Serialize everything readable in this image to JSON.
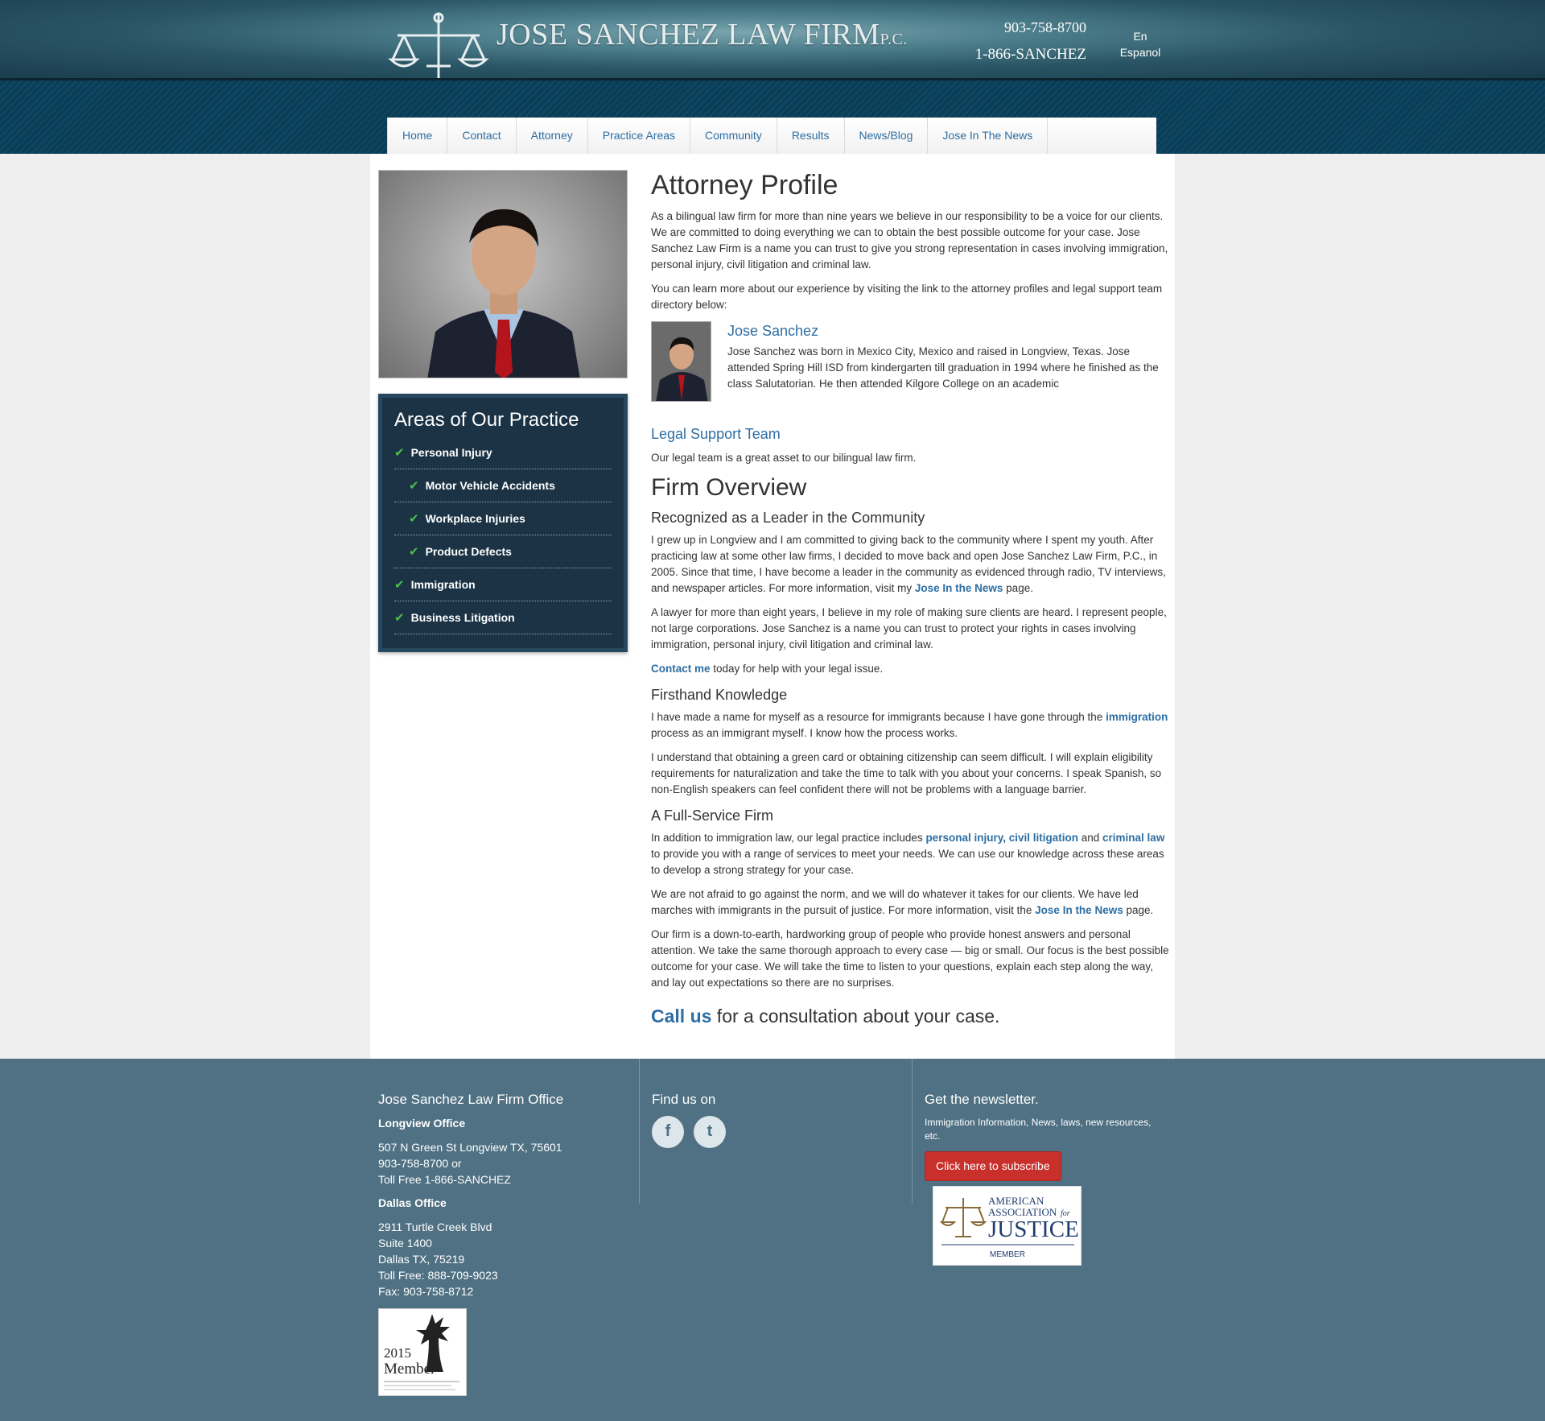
{
  "header": {
    "firm_name": "JOSE SANCHEZ LAW FIRM",
    "firm_suffix": "P.C.",
    "phone_local": "903-758-8700",
    "phone_toll": "1-866-SANCHEZ",
    "lang_line1": "En",
    "lang_line2": "Espanol"
  },
  "nav": {
    "items": [
      "Home",
      "Contact",
      "Attorney",
      "Practice Areas",
      "Community",
      "Results",
      "News/Blog",
      "Jose In The News"
    ]
  },
  "sidebar": {
    "areas_title": "Areas of Our Practice",
    "items": [
      "Personal Injury",
      "Motor Vehicle Accidents",
      "Workplace Injuries",
      "Product Defects",
      "Immigration",
      "Business Litigation"
    ]
  },
  "content": {
    "title": "Attorney Profile",
    "intro": "As a bilingual law firm for more than nine years we believe in our responsibility to be a voice for our clients. We are committed to doing everything we can to obtain the best possible outcome for your case. Jose Sanchez Law Firm is a name you can trust to give you strong representation in cases involving immigration, personal injury, civil litigation and criminal law.",
    "learn_more": "You can learn more about our experience by visiting the link to the attorney profiles and legal support team directory below:",
    "attorney_name": "Jose Sanchez",
    "attorney_bio": "Jose Sanchez was born in Mexico City, Mexico and raised in Longview, Texas. Jose attended Spring Hill ISD from kindergarten till graduation in 1994 where he finished as the class Salutatorian. He then attended Kilgore College on an academic",
    "team_title": "Legal Support Team",
    "team_text": "Our legal team is a great asset to our bilingual law firm.",
    "overview_title": "Firm Overview",
    "leader_title": "Recognized as a Leader in the Community",
    "leader_p1_a": "I grew up in Longview and I am committed to giving back to the community where I spent my youth. After practicing law at some other law firms, I decided to move back and open Jose Sanchez Law Firm, P.C., in 2005. Since that time, I have become a leader in the community as evidenced through radio, TV interviews, and newspaper articles. For more information, visit my ",
    "leader_p1_link": "Jose In the News",
    "leader_p1_b": " page.",
    "leader_p2": "A lawyer for more than eight years, I believe in my role of making sure clients are heard. I represent people, not large corporations. Jose Sanchez is a name you can trust to protect your rights in cases involving immigration, personal injury, civil litigation and criminal law.",
    "contact_link": "Contact me",
    "contact_rest": " today for help with your legal issue.",
    "firsthand_title": "Firsthand Knowledge",
    "firsthand_p1_a": "I have made a name for myself as a resource for immigrants because I have gone through the ",
    "firsthand_p1_link": "immigration",
    "firsthand_p1_b": " process as an immigrant myself. I know how the process works.",
    "firsthand_p2": "I understand that obtaining a green card or obtaining citizenship can seem difficult. I will explain eligibility requirements for naturalization and take the time to talk with you about your concerns. I speak Spanish, so non-English speakers can feel confident there will not be problems with a language barrier.",
    "fullservice_title": "A Full-Service Firm",
    "fs_p1_a": "In addition to immigration law, our legal practice includes ",
    "fs_link_pi": "personal injury",
    "fs_comma": ", ",
    "fs_link_cl": "civil litigation",
    "fs_and": " and ",
    "fs_link_crim": "criminal law",
    "fs_p1_b": " to provide you with a range of services to meet your needs. We can use our knowledge across these areas to develop a strong strategy for your case.",
    "fs_p2_a": "We are not afraid to go against the norm, and we will do whatever it takes for our clients. We have led marches with immigrants in the pursuit of justice. For more information, visit the ",
    "fs_p2_link": "Jose In the News",
    "fs_p2_b": " page.",
    "fs_p3": "Our firm is a down-to-earth, hardworking group of people who provide honest answers and personal attention. We take the same thorough approach to every case — big or small. Our focus is the best possible outcome for your case. We will take the time to listen to your questions, explain each step along the way, and lay out expectations so there are no surprises.",
    "callus_link": "Call us",
    "callus_rest": " for a consultation about your case."
  },
  "footer": {
    "office_title": "Jose Sanchez Law Firm Office",
    "longview_title": "Longview Office",
    "longview_addr": "507 N Green St Longview TX, 75601",
    "longview_phone": "903-758-8700 or",
    "longview_toll": "Toll Free 1-866-SANCHEZ",
    "dallas_title": "Dallas Office",
    "dallas_l1": "2911 Turtle Creek Blvd",
    "dallas_l2": "Suite 1400",
    "dallas_l3": "Dallas TX, 75219",
    "dallas_l4": "Toll Free: 888-709-9023",
    "dallas_l5": "Fax: 903-758-8712",
    "find_title": "Find us on",
    "facebook_glyph": "f",
    "twitter_glyph": "t",
    "news_title": "Get the newsletter.",
    "news_blurb": "Immigration Information, News, laws, new resources, etc.",
    "subscribe_label": "Click here to subscribe",
    "aaj_l1": "AMERICAN",
    "aaj_l2": "ASSOCIATION",
    "aaj_for": "for",
    "aaj_l3": "JUSTICE",
    "aaj_l4": "MEMBER",
    "badge_year": "2015",
    "badge_member": "Member"
  },
  "colors": {
    "link": "#2d6ea3",
    "footer_bg": "#4f7183",
    "sidebar_bg": "#1b3345",
    "subscribe": "#c9302c",
    "check": "#4bbf4b"
  }
}
